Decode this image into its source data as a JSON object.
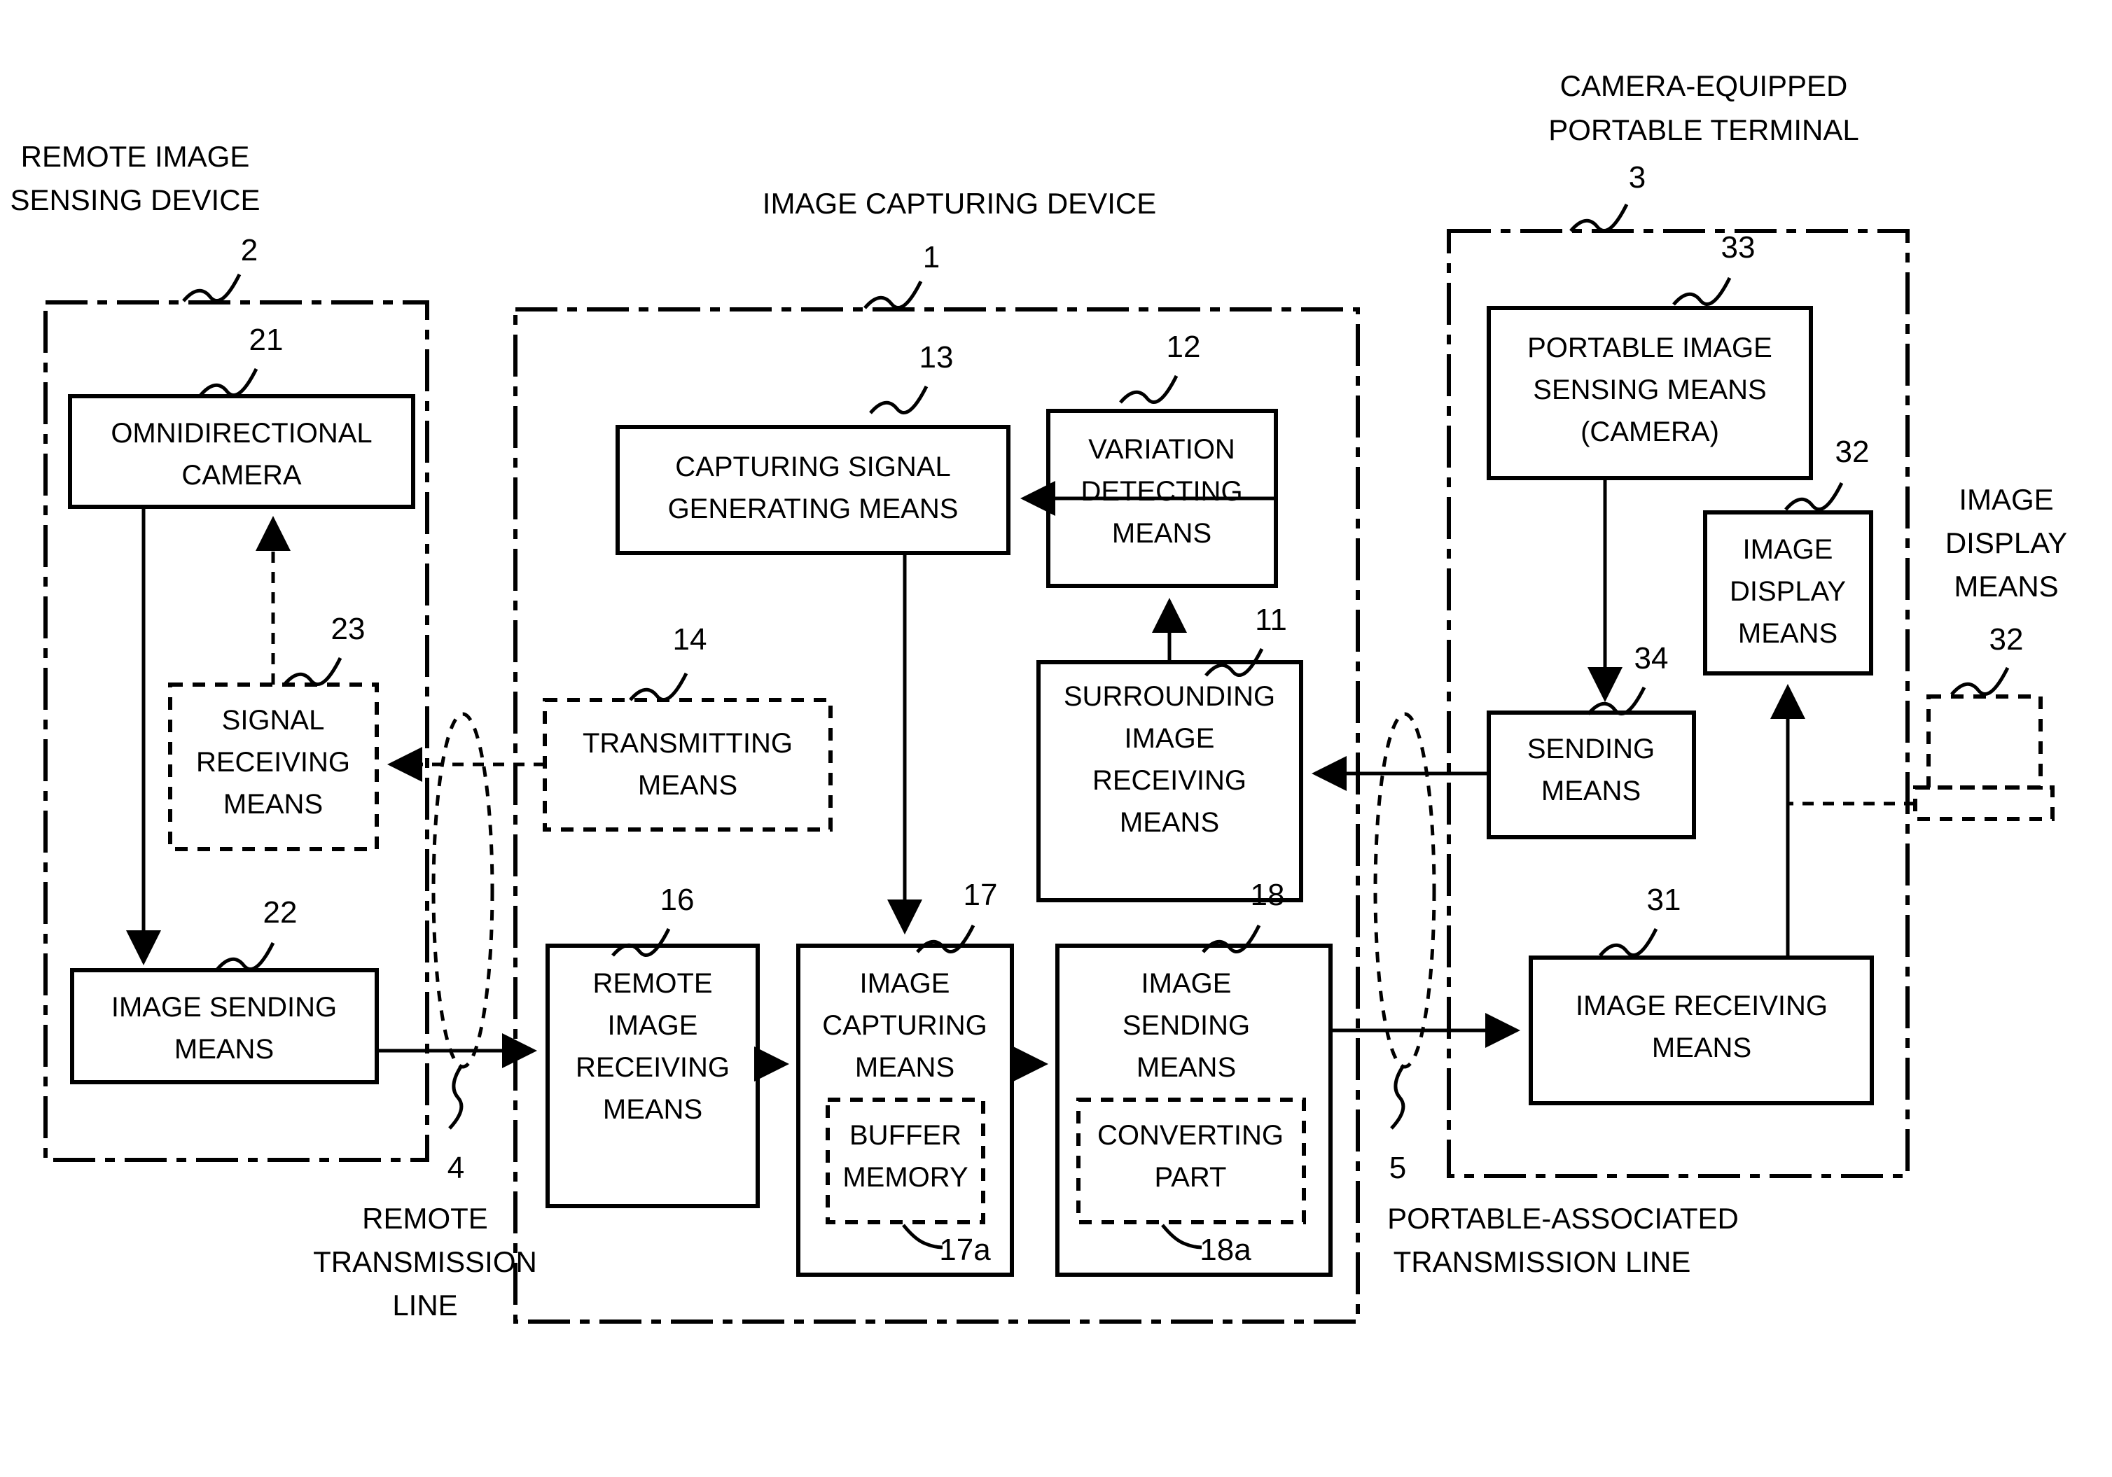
{
  "figure": {
    "groups": [
      {
        "id": "remote-image-sensing-device",
        "title_line1": "REMOTE IMAGE",
        "title_line2": "SENSING DEVICE",
        "ref": "2"
      },
      {
        "id": "image-capturing-device",
        "title_line1": "IMAGE CAPTURING DEVICE",
        "title_line2": "",
        "ref": "1"
      },
      {
        "id": "camera-equipped-portable-terminal",
        "title_line1": "CAMERA-EQUIPPED",
        "title_line2": "PORTABLE TERMINAL",
        "ref": "3"
      }
    ],
    "blocks": [
      {
        "id": "omnidirectional-camera",
        "ref": "21",
        "style": "solid",
        "lines": [
          "OMNIDIRECTIONAL",
          "CAMERA"
        ]
      },
      {
        "id": "signal-receiving-means",
        "ref": "23",
        "style": "dashed",
        "lines": [
          "SIGNAL",
          "RECEIVING",
          "MEANS"
        ]
      },
      {
        "id": "image-sending-means",
        "ref": "22",
        "style": "solid",
        "lines": [
          "IMAGE SENDING",
          "MEANS"
        ]
      },
      {
        "id": "capturing-signal-generating-means",
        "ref": "13",
        "style": "solid",
        "lines": [
          "CAPTURING SIGNAL",
          "GENERATING MEANS"
        ]
      },
      {
        "id": "variation-detecting-means",
        "ref": "12",
        "style": "solid",
        "lines": [
          "VARIATION",
          "DETECTING",
          "MEANS"
        ]
      },
      {
        "id": "surrounding-image-receiving-means",
        "ref": "11",
        "style": "solid",
        "lines": [
          "SURROUNDING",
          "IMAGE",
          "RECEIVING",
          "MEANS"
        ]
      },
      {
        "id": "transmitting-means",
        "ref": "14",
        "style": "dashed",
        "lines": [
          "TRANSMITTING",
          "MEANS"
        ]
      },
      {
        "id": "remote-image-receiving-means",
        "ref": "16",
        "style": "solid",
        "lines": [
          "REMOTE",
          "IMAGE",
          "RECEIVING",
          "MEANS"
        ]
      },
      {
        "id": "image-capturing-means",
        "ref": "17",
        "style": "solid",
        "lines": [
          "IMAGE",
          "CAPTURING",
          "MEANS"
        ]
      },
      {
        "id": "buffer-memory",
        "ref": "17a",
        "style": "dashed",
        "lines": [
          "BUFFER",
          "MEMORY"
        ]
      },
      {
        "id": "image-sending-means-18",
        "ref": "18",
        "style": "solid",
        "lines": [
          "IMAGE",
          "SENDING",
          "MEANS"
        ]
      },
      {
        "id": "converting-part",
        "ref": "18a",
        "style": "dashed",
        "lines": [
          "CONVERTING",
          "PART"
        ]
      },
      {
        "id": "portable-image-sensing-means",
        "ref": "33",
        "style": "solid",
        "lines": [
          "PORTABLE IMAGE",
          "SENSING MEANS",
          "(CAMERA)"
        ]
      },
      {
        "id": "sending-means",
        "ref": "34",
        "style": "solid",
        "lines": [
          "SENDING",
          "MEANS"
        ]
      },
      {
        "id": "image-display-means-32",
        "ref": "32",
        "style": "solid",
        "lines": [
          "IMAGE",
          "DISPLAY",
          "MEANS"
        ]
      },
      {
        "id": "image-receiving-means",
        "ref": "31",
        "style": "solid",
        "lines": [
          "IMAGE RECEIVING",
          "MEANS"
        ]
      },
      {
        "id": "external-monitor",
        "ref": "32",
        "style": "dashed-monitor",
        "lines": []
      }
    ],
    "annotations": [
      {
        "id": "remote-transmission-line",
        "ref": "4",
        "lines": [
          "REMOTE",
          "TRANSMISSION",
          "LINE"
        ]
      },
      {
        "id": "portable-associated-transmission-line",
        "ref": "5",
        "lines": [
          "PORTABLE-ASSOCIATED",
          "TRANSMISSION LINE"
        ]
      },
      {
        "id": "external-image-display-means",
        "ref": "32",
        "lines": [
          "IMAGE",
          "DISPLAY",
          "MEANS"
        ]
      }
    ]
  },
  "text": {
    "grp_remote_l1": "REMOTE IMAGE",
    "grp_remote_l2": "SENSING DEVICE",
    "grp_remote_ref": "2",
    "grp_capture_l1": "IMAGE CAPTURING DEVICE",
    "grp_capture_ref": "1",
    "grp_portable_l1": "CAMERA-EQUIPPED",
    "grp_portable_l2": "PORTABLE TERMINAL",
    "grp_portable_ref": "3",
    "b21_l1": "OMNIDIRECTIONAL",
    "b21_l2": "CAMERA",
    "b21_ref": "21",
    "b23_l1": "SIGNAL",
    "b23_l2": "RECEIVING",
    "b23_l3": "MEANS",
    "b23_ref": "23",
    "b22_l1": "IMAGE SENDING",
    "b22_l2": "MEANS",
    "b22_ref": "22",
    "b13_l1": "CAPTURING SIGNAL",
    "b13_l2": "GENERATING MEANS",
    "b13_ref": "13",
    "b12_l1": "VARIATION",
    "b12_l2": "DETECTING",
    "b12_l3": "MEANS",
    "b12_ref": "12",
    "b11_l1": "SURROUNDING",
    "b11_l2": "IMAGE",
    "b11_l3": "RECEIVING",
    "b11_l4": "MEANS",
    "b11_ref": "11",
    "b14_l1": "TRANSMITTING",
    "b14_l2": "MEANS",
    "b14_ref": "14",
    "b16_l1": "REMOTE",
    "b16_l2": "IMAGE",
    "b16_l3": "RECEIVING",
    "b16_l4": "MEANS",
    "b16_ref": "16",
    "b17_l1": "IMAGE",
    "b17_l2": "CAPTURING",
    "b17_l3": "MEANS",
    "b17_ref": "17",
    "b17a_l1": "BUFFER",
    "b17a_l2": "MEMORY",
    "b17a_ref": "17a",
    "b18_l1": "IMAGE",
    "b18_l2": "SENDING",
    "b18_l3": "MEANS",
    "b18_ref": "18",
    "b18a_l1": "CONVERTING",
    "b18a_l2": "PART",
    "b18a_ref": "18a",
    "b33_l1": "PORTABLE IMAGE",
    "b33_l2": "SENSING MEANS",
    "b33_l3": "(CAMERA)",
    "b33_ref": "33",
    "b34_l1": "SENDING",
    "b34_l2": "MEANS",
    "b34_ref": "34",
    "b32_l1": "IMAGE",
    "b32_l2": "DISPLAY",
    "b32_l3": "MEANS",
    "b32_ref": "32",
    "b31_l1": "IMAGE RECEIVING",
    "b31_l2": "MEANS",
    "b31_ref": "31",
    "ext32_l1": "IMAGE",
    "ext32_l2": "DISPLAY",
    "ext32_l3": "MEANS",
    "ext32_ref": "32",
    "ext_monitor_ref": "32",
    "line4_ref": "4",
    "line4_l1": "REMOTE",
    "line4_l2": "TRANSMISSION",
    "line4_l3": "LINE",
    "line5_ref": "5",
    "line5_l1": "PORTABLE-ASSOCIATED",
    "line5_l2": "TRANSMISSION LINE"
  },
  "colors": {
    "ink": "#000000",
    "paper": "#ffffff"
  }
}
